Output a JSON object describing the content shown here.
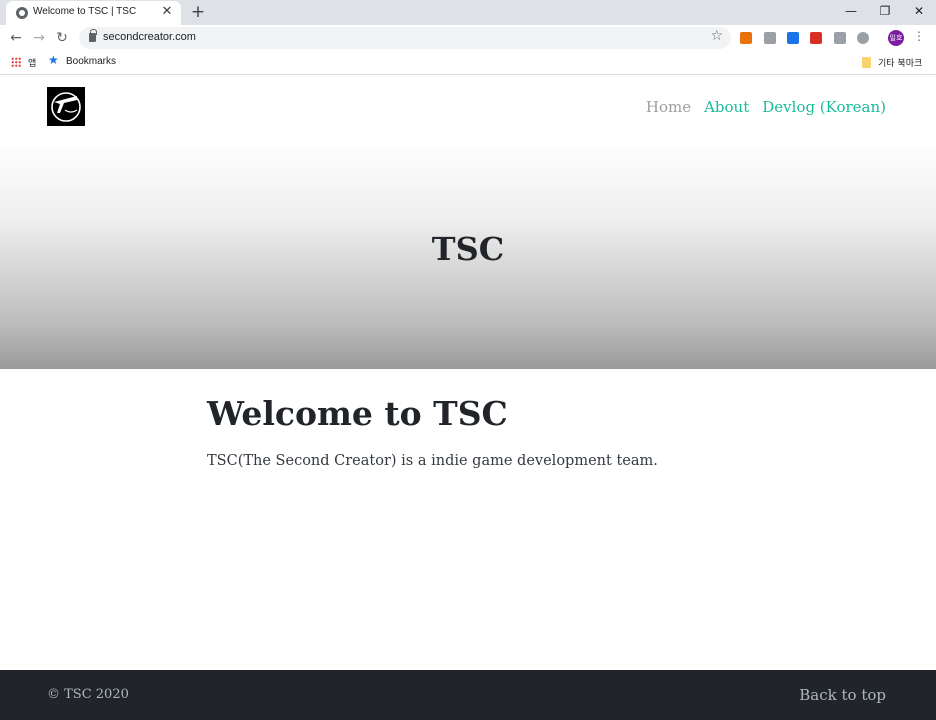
{
  "browser": {
    "tab": {
      "title": "Welcome to TSC | TSC",
      "close_glyph": "✕",
      "favicon": "globe-icon"
    },
    "new_tab_glyph": "+",
    "window_controls": {
      "minimize": "—",
      "restore": "❐",
      "close": "✕"
    },
    "nav": {
      "back": "←",
      "forward": "→",
      "reload": "↻"
    },
    "address_bar": {
      "url": "secondcreator.com",
      "bookmark_star": "☆"
    },
    "profile_initials": "일호",
    "menu_glyph": "⋮",
    "extension_colors": [
      "#e8710a",
      "#9aa0a6",
      "#1a73e8",
      "#d93025",
      "#9aa0a6",
      "#9aa0a6"
    ],
    "bookmarks_bar": {
      "apps_label": "앱",
      "bookmarks_label": "Bookmarks",
      "other_bookmarks_label": "기타 북마크"
    }
  },
  "site": {
    "nav": {
      "home": "Home",
      "about": "About",
      "devlog": "Devlog (Korean)"
    },
    "hero_title": "TSC",
    "main": {
      "heading": "Welcome to TSC",
      "description": "TSC(The Second Creator) is a indie game development team."
    },
    "footer": {
      "copyright": "© TSC 2020",
      "back_to_top": "Back to top"
    }
  }
}
